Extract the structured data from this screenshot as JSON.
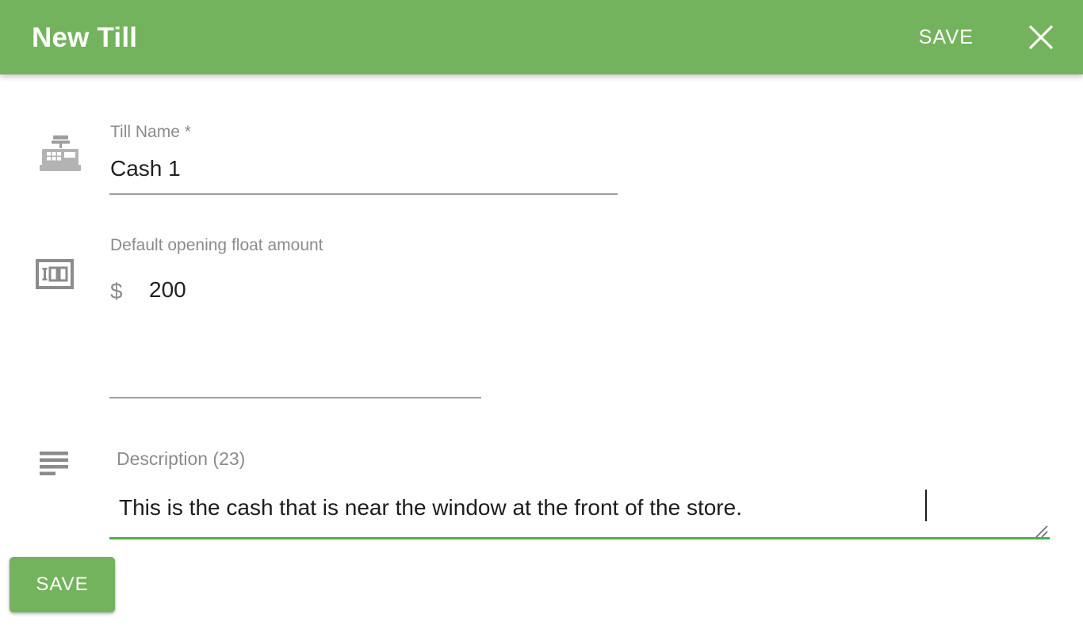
{
  "header": {
    "title": "New Till",
    "save_label": "SAVE",
    "close_icon": "close-icon",
    "background_color": "#74b35d",
    "text_color": "#ffffff"
  },
  "form": {
    "fields": [
      {
        "icon": "cash-register-icon",
        "label": "Till Name *",
        "value": "Cash 1",
        "underline_color": "#9e9e9e"
      },
      {
        "icon": "banknote-icon",
        "label": "Default opening float amount",
        "currency": "$",
        "value": "200",
        "underline_color": "#9e9e9e"
      },
      {
        "icon": "description-lines-icon",
        "label": "Description (23)",
        "value": "This is the cash that is near the window at the front of the store.",
        "underline_color": "#4caf50",
        "focused": true,
        "resize_handle": "resize-handle-icon"
      }
    ]
  },
  "footer": {
    "save_label": "SAVE",
    "save_color": "#74b35d"
  }
}
